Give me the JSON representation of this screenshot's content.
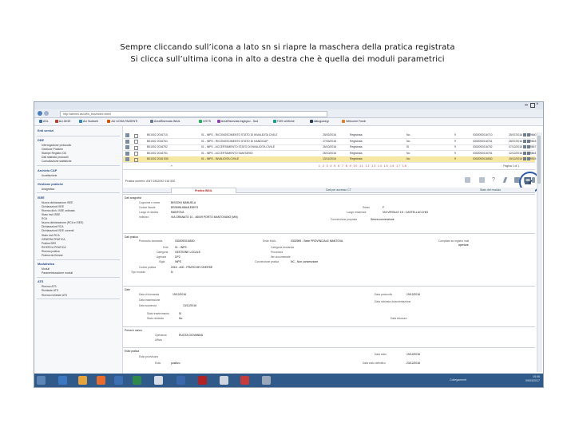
{
  "caption": {
    "line1": "Sempre cliccando sull’icona a lato sn si riapre la maschera della pratica registrata",
    "line2": "Si clicca sull’ultima icona in alto a destra che è quella dei moduli parametrici"
  },
  "browser": {
    "address": "http://ateneo.asl.it/fw_bus/index.xhtml",
    "favorites": [
      "ASL",
      "AU.IDGE",
      "AU Sudweb",
      "AU UOSA PAZIENTI",
      "AreaRiservata INAIL",
      "DSTS",
      "AreaRiservata Ingegno - Sud",
      "TMS verifiche",
      "dialogowegi",
      "Welcome Fondi"
    ]
  },
  "sidebar": {
    "sections": [
      {
        "title": "Enti servizi",
        "items": []
      },
      {
        "title": "DDE",
        "items": [
          "Interrogazione protocollo",
          "Gestione Pratiche",
          "Stampe Registro DD",
          "Dati statistici protocolli",
          "Consultazione statistiche"
        ]
      },
      {
        "title": "Archivio CAP",
        "items": [
          "Accettazione"
        ]
      },
      {
        "title": "Gestione pratiche",
        "items": [
          "Anagrafica"
        ]
      },
      {
        "title": "ISEE",
        "items": [
          "Nuova dichiarazione ISEE",
          "Dichiarazioni ISEE",
          "Ricerca dich. ISEE ordinata",
          "Stato invii ISEE",
          "RCA",
          "Nuova dichiarazione (RCA e ISEE)",
          "Dichiarazioni RCA",
          "Dichiarazioni ISEE correnti",
          "Stato invii RCA",
          "GENERA PRATICA",
          "Pratica BES",
          "RICERCA PRATICA",
          "Ricerca pratica",
          "Pratica da firmare"
        ]
      },
      {
        "title": "Modulistica",
        "items": [
          "Moduli",
          "Parametrizzazione moduli"
        ]
      },
      {
        "title": "ATS",
        "items": [
          "Ricerca ATS",
          "Richieste ATS",
          "Ricerca richieste ATS"
        ]
      }
    ]
  },
  "grid": {
    "rows": [
      {
        "id": "B01002 2016710",
        "desc": "01 - INPS - RICONOSCIMENTO STATO DI INVALIDITA CIVILE",
        "date": "25/02/2016",
        "state": "Registrata",
        "flag": "No",
        "n": "9",
        "prot": "0302092016710",
        "pdate": "25/07/2016",
        "code": "49660"
      },
      {
        "id": "B01002 2016761",
        "desc": "01 - INPS - RICONOSCIMENTO STATO DI HANDICAP",
        "date": "27/03/2016",
        "state": "Registrata",
        "flag": "No",
        "n": "9",
        "prot": "0302092016761",
        "pdate": "28/07/2016",
        "code": "49815"
      },
      {
        "id": "B01002 2016752",
        "desc": "01 - INPS - ACCERTAMENTO STATO DI INVALIDITA CIVILE",
        "date": "26/10/2016",
        "state": "Registrata",
        "flag": "Si",
        "n": "9",
        "prot": "0302092016752",
        "pdate": "07/12/2016",
        "code": "49847"
      },
      {
        "id": "B01002 2016751",
        "desc": "01 - INPS - ACCERTAMENTO SANITARIO",
        "date": "25/10/2016",
        "state": "Registrata",
        "flag": "No",
        "n": "9",
        "prot": "0302092016751",
        "pdate": "12/12/2016",
        "code": "49844"
      },
      {
        "id": "B01002 2016 530",
        "desc": "01 - INPS - INVALIDITA CIVILE",
        "date": "13/11/2016",
        "state": "Registrata",
        "flag": "No",
        "n": "9",
        "prot": "0302092016530",
        "pdate": "19/12/2016",
        "code": "49915"
      }
    ],
    "pager_text": "Pagina 1 di 1"
  },
  "detail": {
    "header": "Pratica numero: ANT 0302092 016 530",
    "tabs": [
      "Pratica INAIL",
      "Dati per accesso CT",
      "Stato del modulo"
    ],
    "sections": {
      "anagrafica": {
        "title": "Dati anagrafici",
        "cognome_label": "Cognome e nome",
        "cognome": "BISSONI MANUELA",
        "cf_label": "Codice fiscale",
        "cf": "BSSMNL68A41E897G",
        "nascita_label": "Luogo di nascita",
        "nascita": "MANTOVA",
        "sesso_label": "Sesso",
        "sesso": "F",
        "indirizzo_label": "Indirizzo",
        "indirizzo": "VIA GRANATO 10 - 46049 PORTO MANTOVANO (MN)",
        "luogo_label": "Luogo residenza",
        "luogo": "VIA VIRGILIO 15 - CASTELLUCCHIO",
        "conv_label": "Convenzione proposta",
        "conv": "Senza convenzione"
      },
      "pratica": {
        "title": "Dati pratica",
        "num_label": "Protocollo domanda",
        "num": "0302092016530",
        "sede_label": "Sede INAIL",
        "sede": "0302989 - Sede PROVINCIALE MANTOVA",
        "dest_label": "Compilato su registro Inail",
        "dest": "aperture",
        "ente_label": "Ente",
        "ente": "01 - INPS",
        "categoria_label": "Categoria",
        "categoria": "GESTIONE LOCALE",
        "cat_right_label": "Categoria domanda",
        "prod_label": "Procedura",
        "prod_right_label": "Iter documentale",
        "agenzia_label": "Agenzia",
        "agenzia": "DP2",
        "sigla_label": "Sigla",
        "sigla": "INPS",
        "conv2_label": "Convenzione pratica",
        "conv2": "NC - Non convenzione",
        "codice_label": "Codice pratica",
        "codice": "2016 - A00 - PRATICHE DIVERSE",
        "tipo_label": "Tipo modulo",
        "tipo": "N"
      },
      "date": {
        "title": "Date",
        "d1_label": "Data di domanda",
        "d1": "19/12/2016",
        "d2_label": "Data protocollo",
        "d2": "19/12/2016",
        "d3_label": "Data trasmissione",
        "d3": "",
        "d4_label": "Data richiesta documentazione",
        "d4": "",
        "d5_label": "Data scadenza",
        "d5": "13/12/2016",
        "d6_label": "Stato trasferimento",
        "d6": "Si",
        "d7_label": "Stato richiesta",
        "d7": "No",
        "d8_label": "Data chiusura",
        "d8": ""
      },
      "presa": {
        "title": "Presa in carico",
        "p1_label": "Operatore",
        "p1": "RUOTA GIOVANNA",
        "p2_label": "Ufficio",
        "p2": ""
      },
      "esito": {
        "title": "Esito pratica",
        "e1_label": "Esito provvisorio",
        "e1": "",
        "e2_label": "Data esito",
        "e2": "19/12/2016",
        "e3_label": "Esito",
        "e3": "positivo",
        "e4_label": "Data esito definitivo",
        "e4": "23/12/2016"
      }
    }
  },
  "taskbar": {
    "time": "15:06",
    "date": "09/03/2017",
    "tray_text": "Collegamenti"
  },
  "colors": {
    "highlight": "#2f5aa6",
    "selected_row": "#f6e7a2",
    "taskbar": "#2f5a8a"
  }
}
